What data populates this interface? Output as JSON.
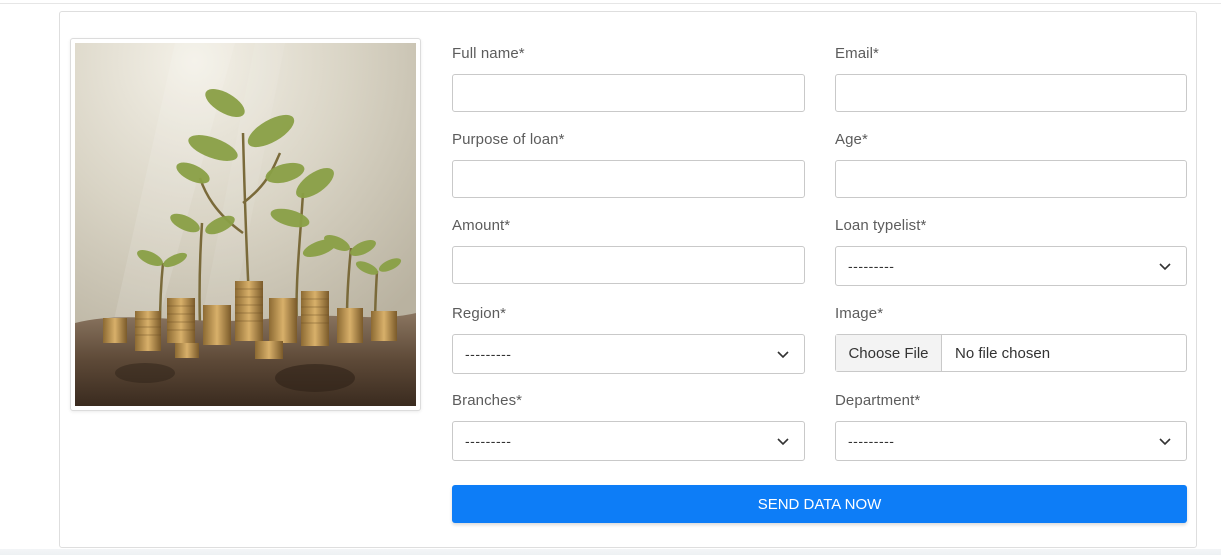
{
  "form": {
    "full_name": {
      "label": "Full name*",
      "value": ""
    },
    "email": {
      "label": "Email*",
      "value": ""
    },
    "purpose": {
      "label": "Purpose of loan*",
      "value": ""
    },
    "age": {
      "label": "Age*",
      "value": ""
    },
    "amount": {
      "label": "Amount*",
      "value": ""
    },
    "loan_type": {
      "label": "Loan typelist*",
      "selected": "---------"
    },
    "region": {
      "label": "Region*",
      "selected": "---------"
    },
    "image": {
      "label": "Image*",
      "button": "Choose File",
      "status": "No file chosen"
    },
    "branches": {
      "label": "Branches*",
      "selected": "---------"
    },
    "department": {
      "label": "Department*",
      "selected": "---------"
    },
    "submit_label": "SEND DATA NOW"
  },
  "image_description": "seedlings-growing-from-coin-stacks-in-soil",
  "colors": {
    "accent": "#0d7df7",
    "label": "#5c5c5c",
    "border": "#c9c9c9"
  }
}
